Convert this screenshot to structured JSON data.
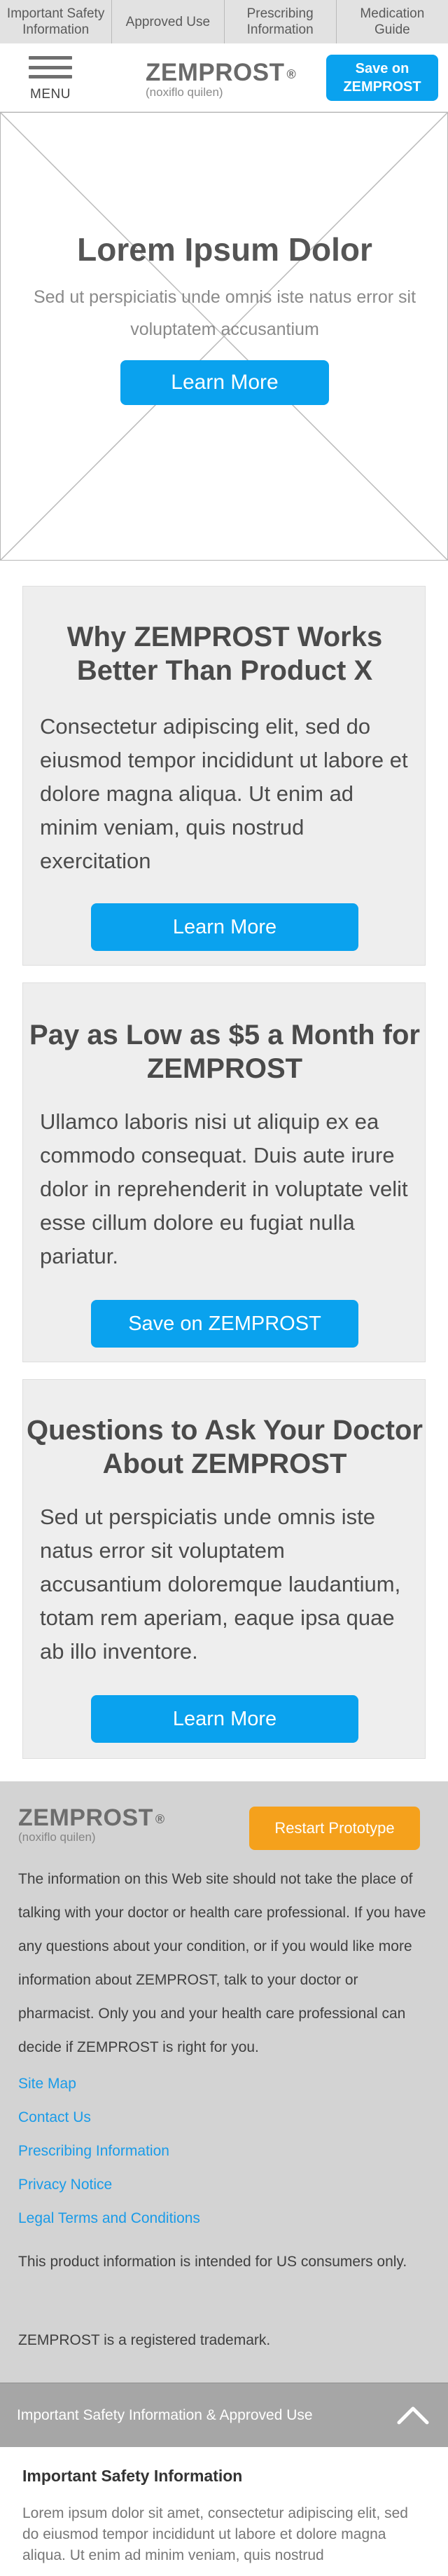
{
  "top_nav": {
    "items": [
      "Important Safety Information",
      "Approved Use",
      "Prescribing Information",
      "Medication Guide"
    ]
  },
  "header": {
    "menu_label": "MENU",
    "brand": "ZEMPROST",
    "brand_mark": "®",
    "brand_generic": "(noxiflo quilen)",
    "save_button": "Save on ZEMPROST"
  },
  "hero": {
    "title": "Lorem Ipsum Dolor",
    "text": "Sed ut perspiciatis unde omnis iste natus error sit voluptatem accusantium",
    "button": "Learn More"
  },
  "cards": [
    {
      "title": "Why ZEMPROST Works Better Than Product X",
      "text": "Consectetur adipiscing elit, sed do eiusmod tempor incididunt ut labore et dolore magna aliqua. Ut enim ad minim veniam, quis nostrud exercitation",
      "button": "Learn More"
    },
    {
      "title": "Pay as Low as $5 a Month for ZEMPROST",
      "text": "Ullamco laboris nisi ut aliquip ex ea commodo consequat. Duis aute irure dolor in reprehenderit in voluptate velit esse cillum dolore eu fugiat nulla pariatur.",
      "button": "Save on ZEMPROST"
    },
    {
      "title": "Questions to Ask Your Doctor About ZEMPROST",
      "text": "Sed ut perspiciatis unde omnis iste natus error sit voluptatem accusantium doloremque laudantium, totam rem aperiam, eaque ipsa quae ab illo inventore.",
      "button": "Learn More"
    }
  ],
  "footer": {
    "brand": "ZEMPROST",
    "brand_mark": "®",
    "brand_generic": "(noxiflo quilen)",
    "restart_button": "Restart Prototype",
    "disclaimer": "The information on this Web site should not take the place of talking with your doctor or health care professional. If you have any questions about your condition, or if you would like more information about ZEMPROST, talk to your doctor or pharmacist. Only you and your health care professional can decide if ZEMPROST is right for you.",
    "links": [
      "Site Map",
      "Contact Us",
      "Prescribing Information",
      "Privacy Notice",
      "Legal Terms and Conditions"
    ],
    "us_note": "This product information is intended for US consumers only.",
    "trademark": "ZEMPROST is a registered trademark."
  },
  "isi": {
    "bar_label": "Important Safety Information & Approved Use",
    "title": "Important Safety Information",
    "text": "Lorem ipsum dolor sit amet, consectetur adipiscing elit, sed do eiusmod tempor incididunt ut labore et dolore magna aliqua. Ut enim ad minim veniam, quis nostrud"
  },
  "colors": {
    "accent_blue": "#0aa2ee",
    "accent_orange": "#f5a11c",
    "link_blue": "#1a9be8"
  },
  "icons": {
    "menu": "hamburger-icon",
    "isi_toggle": "chevron-up-icon"
  }
}
